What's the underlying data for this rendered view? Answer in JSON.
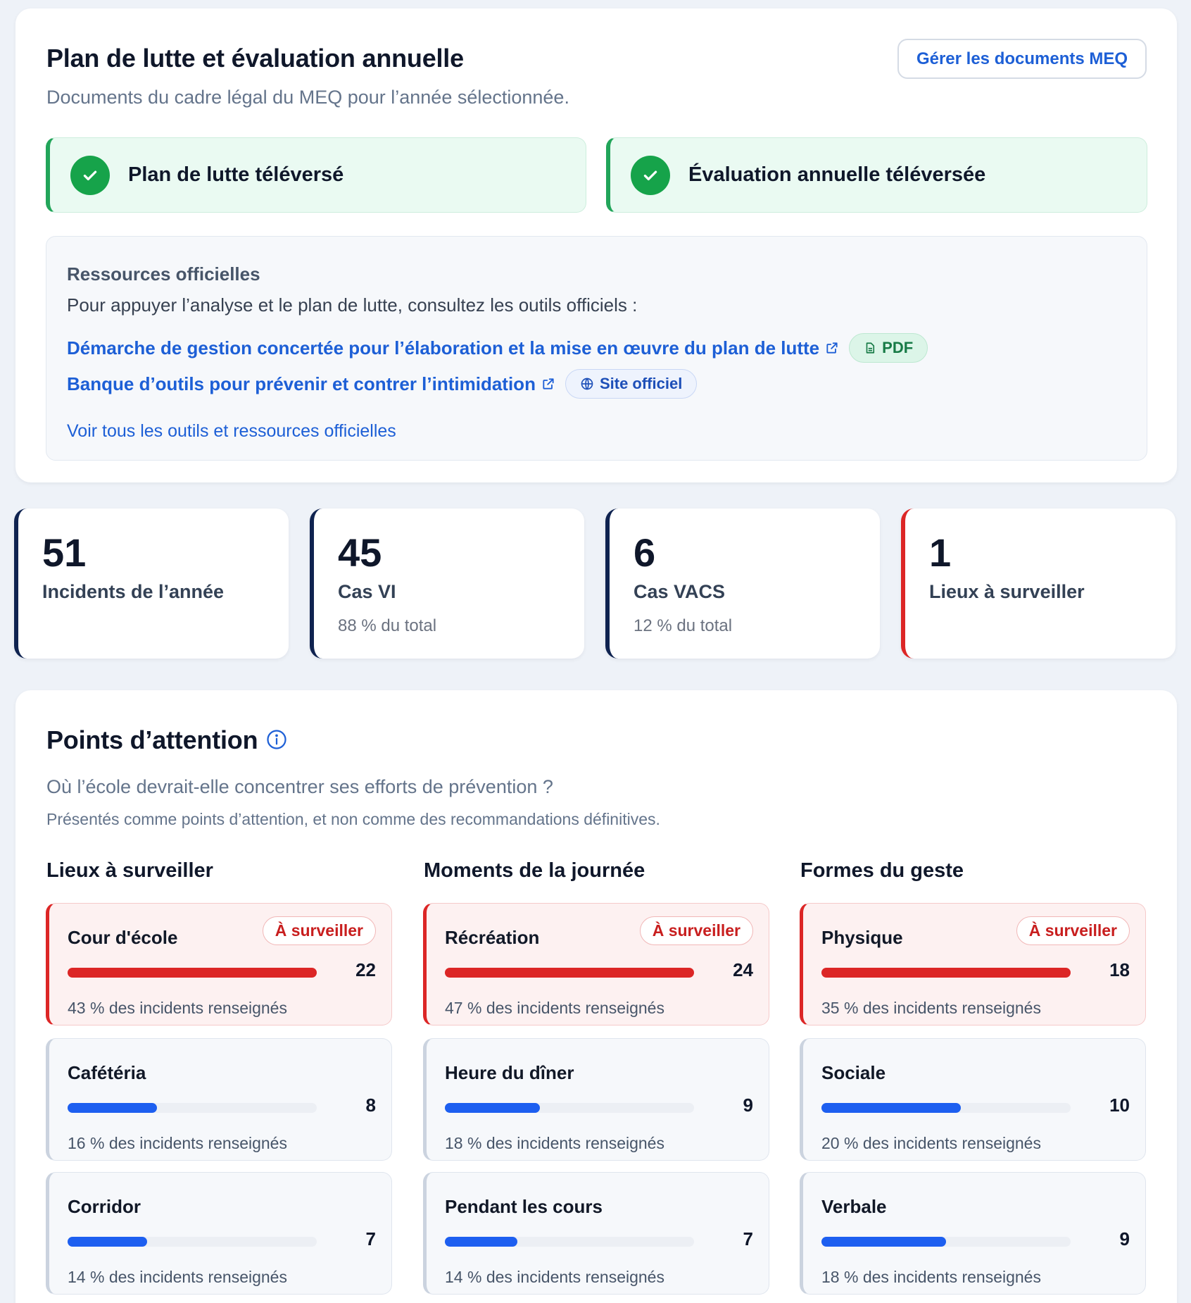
{
  "plan": {
    "title": "Plan de lutte et évaluation annuelle",
    "subtitle": "Documents du cadre légal du MEQ pour l’année sélectionnée.",
    "manage_button": "Gérer les documents MEQ",
    "status": [
      {
        "label": "Plan de lutte téléversé"
      },
      {
        "label": "Évaluation annuelle téléversée"
      }
    ],
    "resources": {
      "title": "Ressources officielles",
      "intro": "Pour appuyer l’analyse et le plan de lutte, consultez les outils officiels :",
      "links": [
        {
          "text": "Démarche de gestion concertée pour l’élaboration et la mise en œuvre du plan de lutte",
          "tag": "PDF",
          "tag_icon": "document-icon"
        },
        {
          "text": "Banque d’outils pour prévenir et contrer l’intimidation",
          "tag": "Site officiel",
          "tag_icon": "globe-icon"
        }
      ],
      "see_all": "Voir tous les outils et ressources officielles"
    }
  },
  "stats": [
    {
      "value": "51",
      "label": "Incidents de l’année",
      "note": ""
    },
    {
      "value": "45",
      "label": "Cas VI",
      "note": "88 % du total"
    },
    {
      "value": "6",
      "label": "Cas VACS",
      "note": "12 % du total"
    },
    {
      "value": "1",
      "label": "Lieux à surveiller",
      "note": ""
    }
  ],
  "attention": {
    "title": "Points d’attention",
    "question": "Où l’école devrait-elle concentrer ses efforts de prévention ?",
    "disclaimer": "Présentés comme points d’attention, et non comme des recommandations définitives.",
    "badge_label": "À surveiller",
    "columns": [
      {
        "title": "Lieux à surveiller",
        "items": [
          {
            "name": "Cour d'école",
            "count": "22",
            "share": "43 % des incidents renseignés",
            "flagged": true,
            "fill": 1.0
          },
          {
            "name": "Cafétéria",
            "count": "8",
            "share": "16 % des incidents renseignés",
            "flagged": false,
            "fill": 0.36
          },
          {
            "name": "Corridor",
            "count": "7",
            "share": "14 % des incidents renseignés",
            "flagged": false,
            "fill": 0.32
          }
        ]
      },
      {
        "title": "Moments de la journée",
        "items": [
          {
            "name": "Récréation",
            "count": "24",
            "share": "47 % des incidents renseignés",
            "flagged": true,
            "fill": 1.0
          },
          {
            "name": "Heure du dîner",
            "count": "9",
            "share": "18 % des incidents renseignés",
            "flagged": false,
            "fill": 0.38
          },
          {
            "name": "Pendant les cours",
            "count": "7",
            "share": "14 % des incidents renseignés",
            "flagged": false,
            "fill": 0.29
          }
        ]
      },
      {
        "title": "Formes du geste",
        "items": [
          {
            "name": "Physique",
            "count": "18",
            "share": "35 % des incidents renseignés",
            "flagged": true,
            "fill": 1.0
          },
          {
            "name": "Sociale",
            "count": "10",
            "share": "20 % des incidents renseignés",
            "flagged": false,
            "fill": 0.56
          },
          {
            "name": "Verbale",
            "count": "9",
            "share": "18 % des incidents renseignés",
            "flagged": false,
            "fill": 0.5
          }
        ]
      }
    ]
  },
  "colors": {
    "success": "#16a34a",
    "alert": "#dc2626",
    "accent": "#1d5fd6",
    "navy": "#0f2350"
  }
}
